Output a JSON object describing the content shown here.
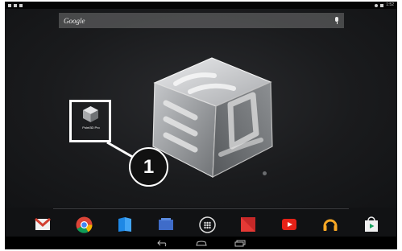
{
  "search": {
    "label": "Google"
  },
  "status": {
    "clock": "1:52"
  },
  "app": {
    "label": "Point3D Pro"
  },
  "callout": {
    "number": "1"
  },
  "colors": {
    "highlight": "#ffffff",
    "callout_bg": "#111111",
    "wallpaper": "#1a1b1d"
  },
  "dock": {
    "items": [
      {
        "icon": "gmail-icon"
      },
      {
        "icon": "chrome-icon"
      },
      {
        "icon": "play-books-icon"
      },
      {
        "icon": "play-magazines-icon"
      },
      {
        "icon": "app-drawer-icon"
      },
      {
        "icon": "play-movies-icon"
      },
      {
        "icon": "youtube-icon"
      },
      {
        "icon": "play-music-icon"
      },
      {
        "icon": "play-store-icon"
      }
    ]
  },
  "navbar": {
    "items": [
      {
        "icon": "back-icon"
      },
      {
        "icon": "home-icon"
      },
      {
        "icon": "recents-icon"
      }
    ]
  }
}
